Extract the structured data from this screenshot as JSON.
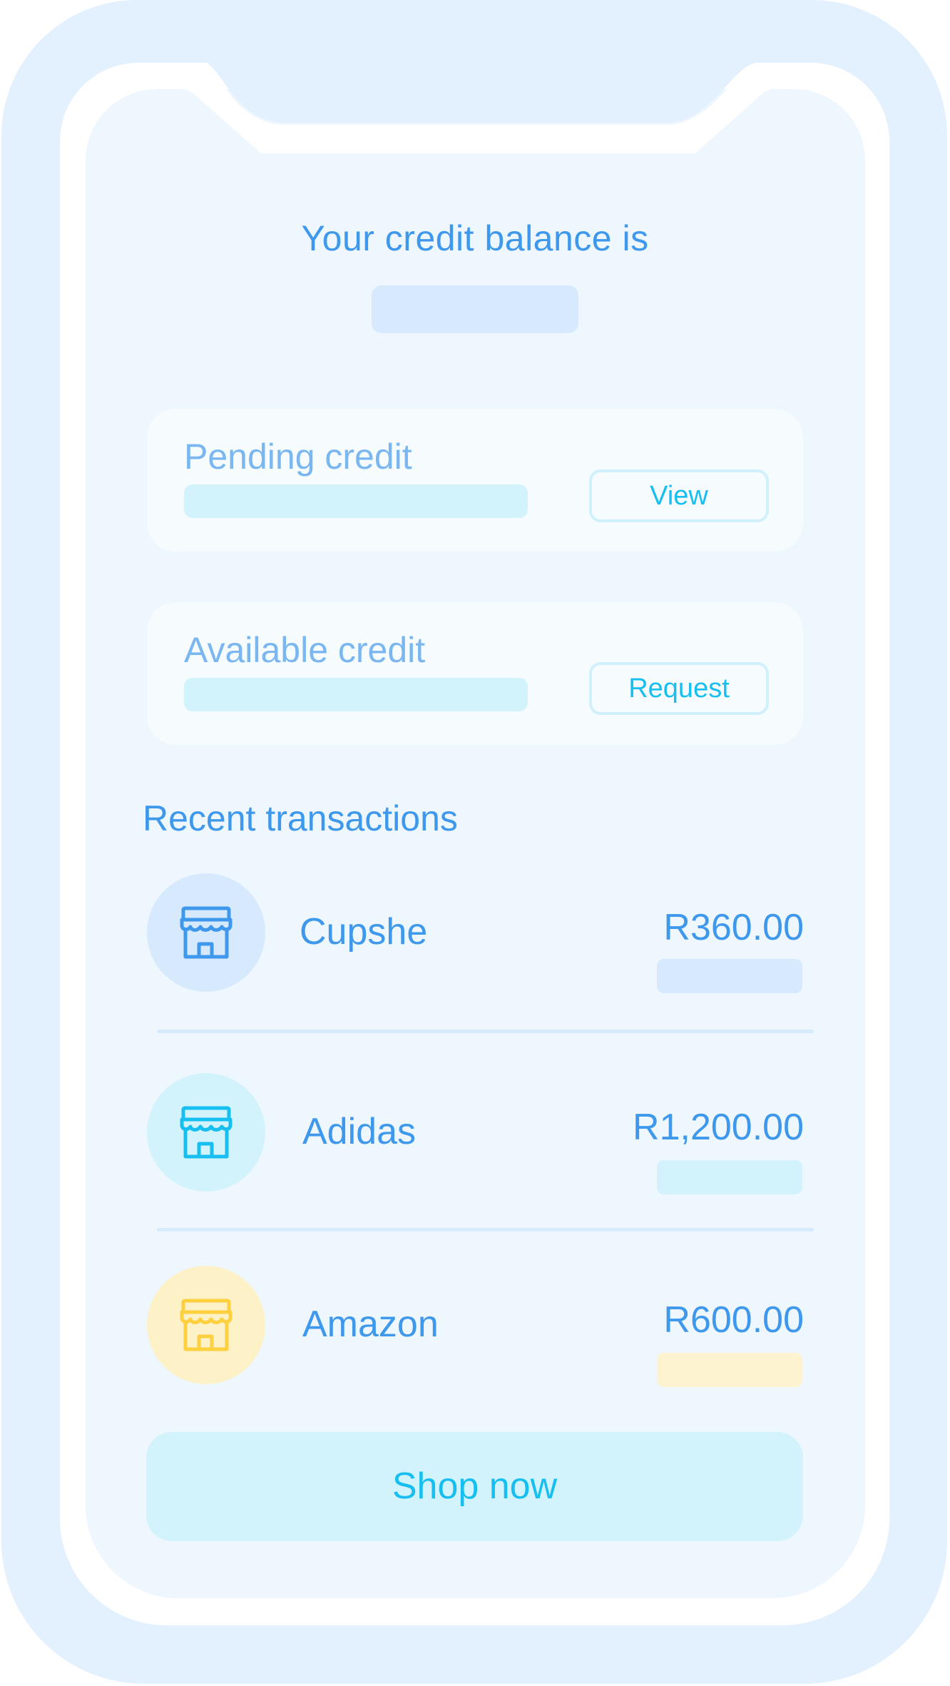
{
  "header": {
    "title": "Your credit balance is"
  },
  "cards": [
    {
      "label": "Pending credit",
      "button_label": "View"
    },
    {
      "label": "Available credit",
      "button_label": "Request"
    }
  ],
  "transactions": {
    "title": "Recent transactions",
    "items": [
      {
        "merchant": "Cupshe",
        "amount": "R360.00",
        "icon": "store-icon",
        "color": "#3e98ec"
      },
      {
        "merchant": "Adidas",
        "amount": "R1,200.00",
        "icon": "store-icon",
        "color": "#16bff0"
      },
      {
        "merchant": "Amazon",
        "amount": "R600.00",
        "icon": "store-icon",
        "color": "#fdd040"
      }
    ]
  },
  "footer": {
    "shop_button_label": "Shop now"
  },
  "colors": {
    "primary_text": "#3e98ec",
    "accent_cyan": "#16bff0",
    "accent_yellow": "#fdd040",
    "phone_frame": "#e3f0fd",
    "screen_background": "#eef6fe"
  }
}
